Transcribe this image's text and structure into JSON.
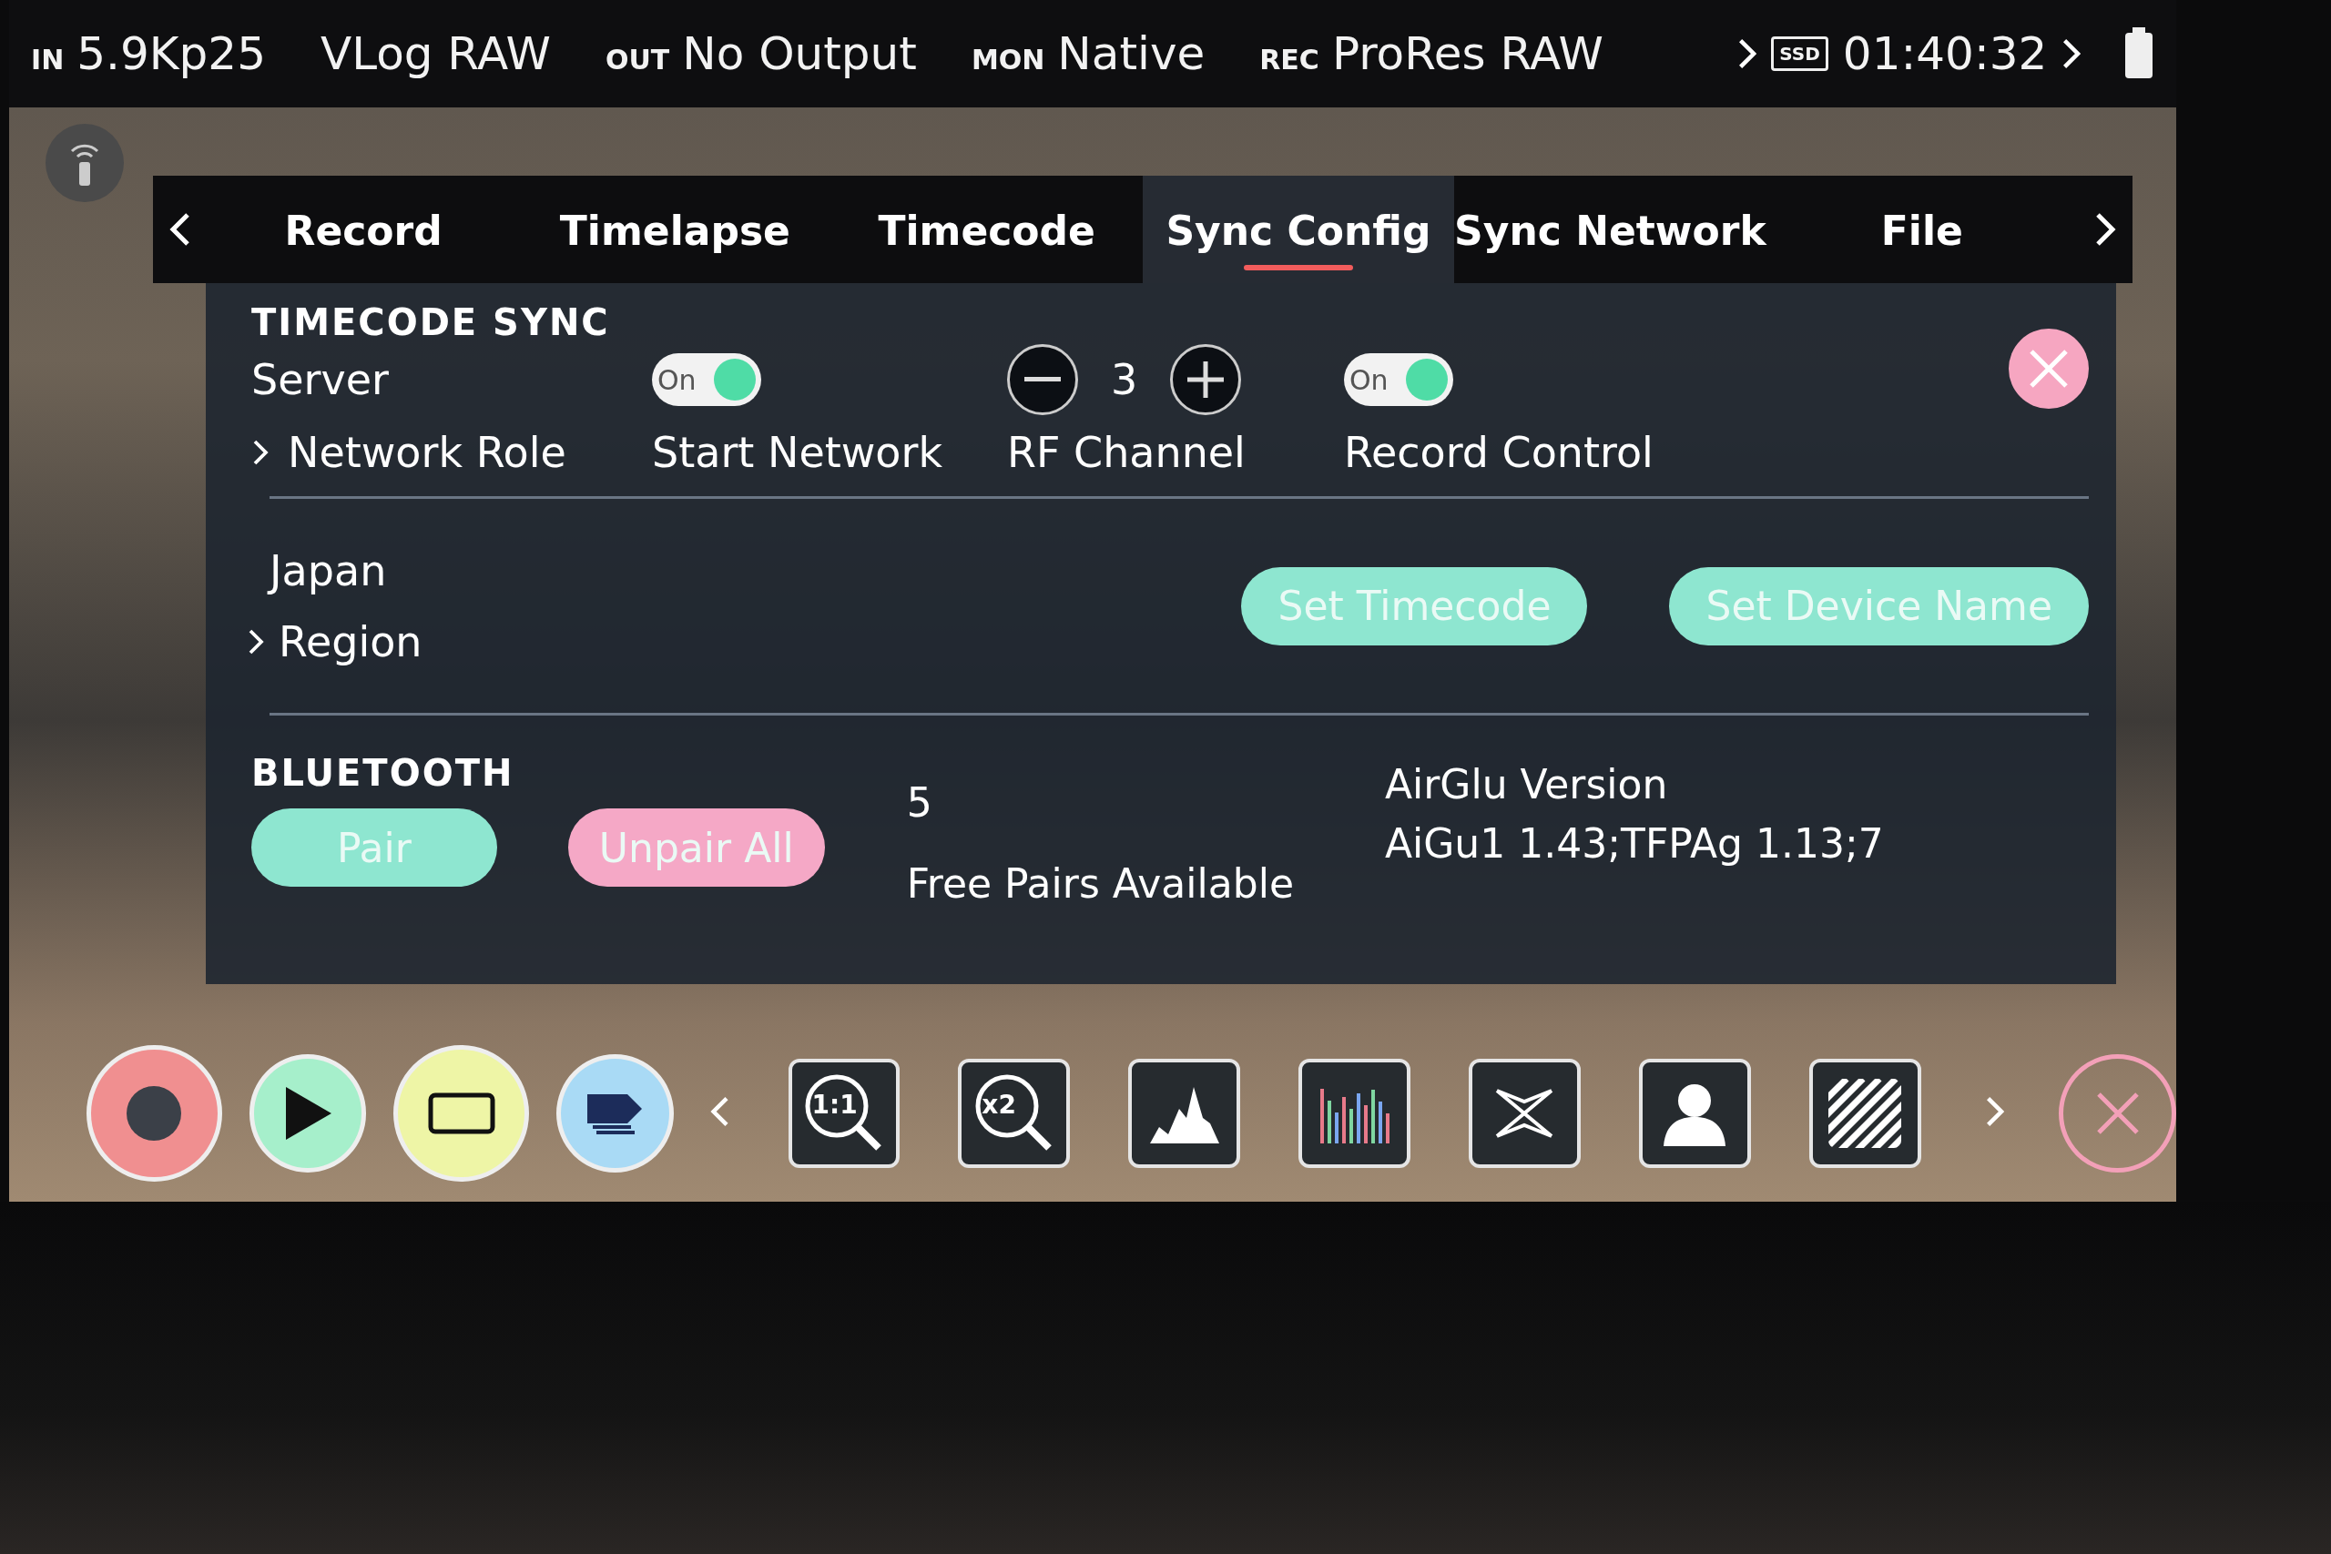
{
  "status_bar": {
    "items": [
      {
        "label": "IN",
        "value": "5.9Kp25"
      },
      {
        "value": "VLog RAW"
      },
      {
        "label": "OUT",
        "value": "No Output"
      },
      {
        "label": "MON",
        "value": "Native"
      },
      {
        "label": "REC",
        "value": "ProRes RAW"
      }
    ],
    "media": "SSD",
    "time": "01:40:32"
  },
  "tabs": [
    {
      "label": "Record",
      "selected": false
    },
    {
      "label": "Timelapse",
      "selected": false
    },
    {
      "label": "Timecode",
      "selected": false
    },
    {
      "label": "Sync Config",
      "selected": true
    },
    {
      "label": "Sync Network",
      "selected": false
    },
    {
      "label": "File",
      "selected": false
    }
  ],
  "timecode_sync": {
    "heading": "TIMECODE SYNC",
    "network_role": {
      "value": "Server",
      "label": "Network Role"
    },
    "start_network": {
      "on": true,
      "state_text": "On",
      "label": "Start Network"
    },
    "rf_channel": {
      "value": "3",
      "label": "RF Channel"
    },
    "record_control": {
      "on": true,
      "state_text": "On",
      "label": "Record Control"
    },
    "region": {
      "value": "Japan",
      "label": "Region"
    },
    "buttons": [
      {
        "label": "Set Timecode"
      },
      {
        "label": "Set Device Name"
      }
    ]
  },
  "bluetooth": {
    "heading": "BLUETOOTH",
    "pair": "Pair",
    "unpair": "Unpair All",
    "free_pairs": {
      "count": "5",
      "label": "Free Pairs Available"
    },
    "version": {
      "label": "AirGlu Version",
      "value": "AiGu1 1.43;TFPAg 1.13;7"
    }
  },
  "toolbar": [
    {
      "kind": "record"
    },
    {
      "kind": "play"
    },
    {
      "kind": "monitor"
    },
    {
      "kind": "tags"
    },
    {
      "kind": "prev"
    },
    {
      "kind": "zoom",
      "label": "1:1"
    },
    {
      "kind": "zoom",
      "label": "x2"
    },
    {
      "kind": "histogram"
    },
    {
      "kind": "waveform"
    },
    {
      "kind": "vectorscope"
    },
    {
      "kind": "silhouette"
    },
    {
      "kind": "zebra"
    },
    {
      "kind": "next"
    },
    {
      "kind": "close"
    }
  ]
}
